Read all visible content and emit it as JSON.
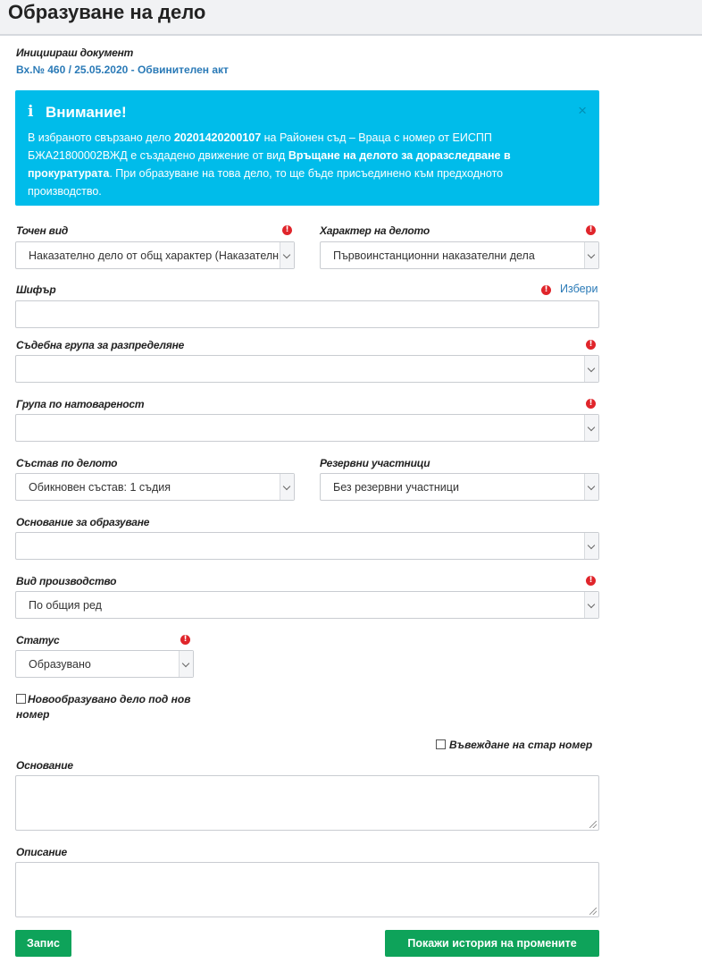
{
  "page": {
    "title": "Образуване на дело"
  },
  "initiating_doc": {
    "label": "Инициираш документ",
    "link": "Вх.№ 460 / 25.05.2020 - Обвинителен акт"
  },
  "alert": {
    "icon": "info-icon",
    "title": "Внимание!",
    "close": "×",
    "t1": "В избраното свързано дело ",
    "case_number": "20201420200107",
    "t2": " на Районен съд – Враца с номер от ЕИСПП БЖА21800002ВЖД е създадено движение от вид ",
    "movement": "Връщане на делото за доразследване в прокуратурата",
    "t3": ". При образуване на това дело, то ще бъде присъединено към предходното производство."
  },
  "form": {
    "exact_type": {
      "label": "Точен вид",
      "value": "Наказателно дело от общ характер (Наказателно"
    },
    "case_character": {
      "label": "Характер на делото",
      "value": "Първоинстанционни наказателни дела"
    },
    "cipher": {
      "label": "Шифър",
      "link": "Избери",
      "value": ""
    },
    "court_group": {
      "label": "Съдебна група за разпределяне",
      "value": ""
    },
    "load_group": {
      "label": "Група по натовареност",
      "value": ""
    },
    "composition": {
      "label": "Състав по делото",
      "value": "Обикновен състав: 1 съдия"
    },
    "reserve": {
      "label": "Резервни участници",
      "value": "Без резервни участници"
    },
    "grounds_init": {
      "label": "Основание за образуване",
      "value": ""
    },
    "proceeding_type": {
      "label": "Вид производство",
      "value": "По общия ред"
    },
    "status": {
      "label": "Статус",
      "value": "Образувано"
    },
    "new_case_cb": {
      "label": "Новообразувано дело под нов номер",
      "checked": false
    },
    "old_number_cb": {
      "label": "Въвеждане на стар номер",
      "checked": false
    },
    "basis": {
      "label": "Основание",
      "value": ""
    },
    "description": {
      "label": "Описание",
      "value": ""
    }
  },
  "buttons": {
    "save": "Запис",
    "history": "Покажи история на промените"
  },
  "colors": {
    "alert_bg": "#00bcea",
    "button_green": "#0ea35a",
    "required_red": "#e0252b",
    "link_blue": "#2a7ab7"
  }
}
